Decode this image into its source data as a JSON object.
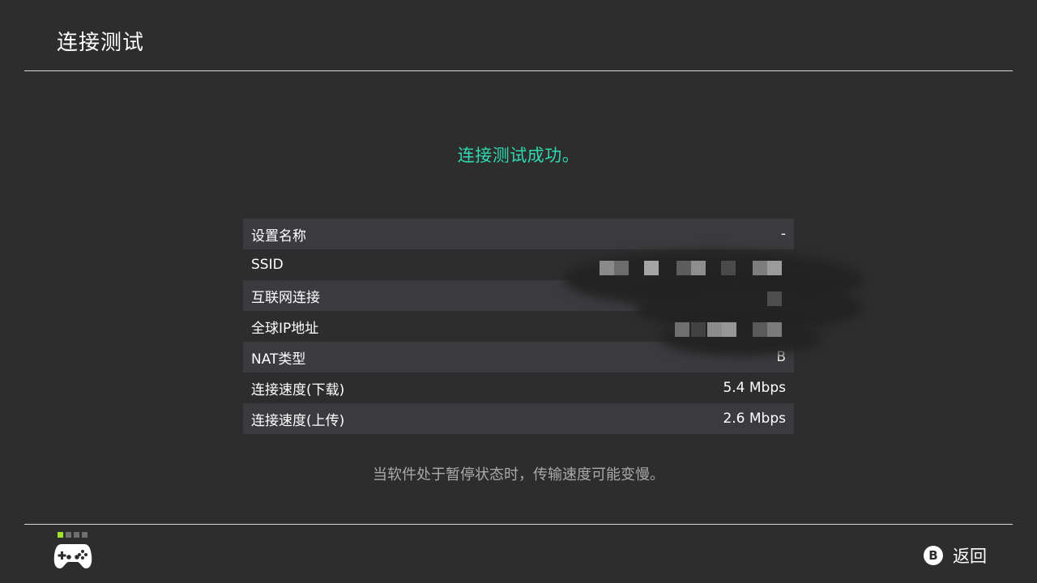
{
  "header": {
    "title": "连接测试"
  },
  "result": {
    "message": "连接测试成功。",
    "color": "#2ed9b0"
  },
  "table": {
    "rows": [
      {
        "label": "设置名称",
        "value": "-"
      },
      {
        "label": "SSID",
        "value": ""
      },
      {
        "label": "互联网连接",
        "value": "成功"
      },
      {
        "label": "全球IP地址",
        "value": ""
      },
      {
        "label": "NAT类型",
        "value": "B"
      },
      {
        "label": "连接速度(下载)",
        "value": "5.4 Mbps"
      },
      {
        "label": "连接速度(上传)",
        "value": "2.6 Mbps"
      }
    ]
  },
  "note": "当软件处于暂停状态时，传输速度可能变慢。",
  "footer": {
    "controller_icon": "gamepad-icon",
    "page_indicator": {
      "total": 4,
      "active": 1,
      "active_color": "#9fe32a"
    },
    "back": {
      "button": "B",
      "label": "返回"
    }
  }
}
